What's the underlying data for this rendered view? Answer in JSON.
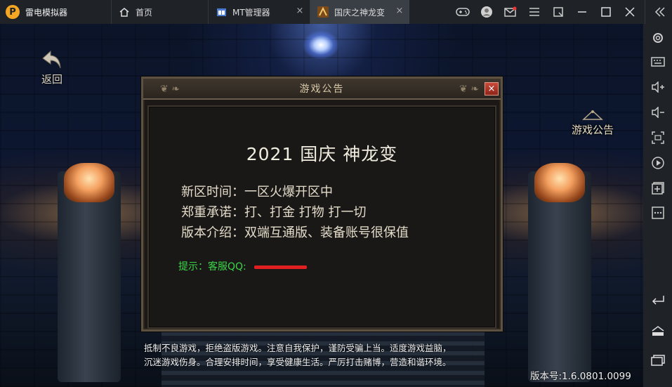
{
  "app": {
    "name": "雷电模拟器",
    "logo_glyph": "P",
    "accent_color": "#f5a623"
  },
  "tabs": [
    {
      "label": "首页",
      "icon": "home-icon"
    },
    {
      "label": "MT管理器",
      "icon": "mt-manager-icon"
    },
    {
      "label": "国庆之神龙变",
      "icon": "game-icon",
      "active": true
    }
  ],
  "titlebar_buttons": [
    "gamepad-icon",
    "user-avatar-icon",
    "mail-icon",
    "menu-icon",
    "fullscreen-icon",
    "minimize-icon",
    "maximize-icon",
    "close-icon",
    "collapse-sidebar-icon"
  ],
  "game": {
    "back_label": "返回",
    "notice_button_label": "游戏公告",
    "dialog": {
      "title": "游戏公告",
      "close_glyph": "×",
      "headline": "2021 国庆  神龙变",
      "lines": [
        "新区时间：一区火爆开区中",
        "郑重承诺：打、打金 打物 打一切",
        "版本介绍：双端互通版、装备账号很保值"
      ],
      "tip": "提示：客服QQ:"
    },
    "health_notice": [
      "抵制不良游戏，拒绝盗版游戏。注意自我保护，谨防受骗上当。适度游戏益脑，",
      "沉迷游戏伤身。合理安排时间，享受健康生活。严厉打击赌博，营造和谐环境。"
    ],
    "version": "版本号:1.6.0801.0099"
  },
  "sidebar_buttons": [
    "settings-icon",
    "keyboard-icon",
    "volume-up-icon",
    "volume-down-icon",
    "screenshot-icon",
    "record-icon",
    "add-app-icon",
    "more-icon",
    "back-icon",
    "home-nav-icon",
    "recent-apps-icon"
  ]
}
